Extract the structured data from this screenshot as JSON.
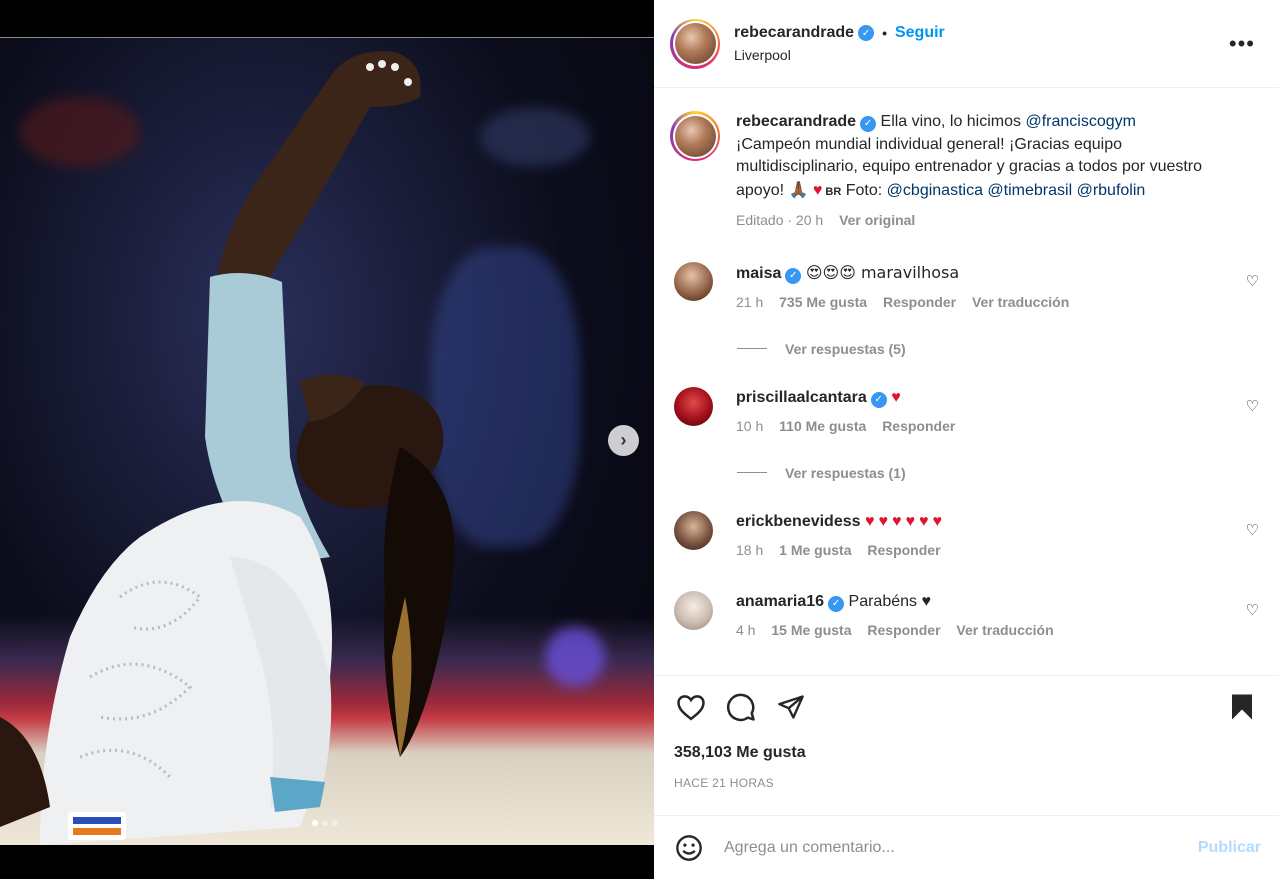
{
  "post": {
    "username": "rebecarandrade",
    "follow_label": "Seguir",
    "separator": "•",
    "location": "Liverpool",
    "more_label": "•••"
  },
  "caption": {
    "username": "rebecarandrade",
    "text_1": "Ella vino, lo hicimos ",
    "mention_1": "@franciscogym",
    "text_2": " ¡Campeón mundial individual general! ¡Gracias equipo multidisciplinario, equipo entrenador y gracias a todos por vuestro apoyo! ",
    "emojis": "🙏🏾",
    "heart": "♥",
    "flag": " BR",
    "text_3": " Foto: ",
    "mention_2": "@cbginastica",
    "mention_3": "@timebrasil",
    "mention_4": "@rbufolin",
    "edited": "Editado · 20 h",
    "see_original": "Ver original"
  },
  "comments": [
    {
      "username": "maisa",
      "verified": true,
      "text": "😍😍😍 maravilhosa",
      "time": "21 h",
      "likes": "735 Me gusta",
      "reply": "Responder",
      "translate": "Ver traducción",
      "replies": "Ver respuestas (5)"
    },
    {
      "username": "priscillaalcantara",
      "verified": true,
      "text": "♥",
      "time": "10 h",
      "likes": "110 Me gusta",
      "reply": "Responder",
      "translate": "",
      "replies": "Ver respuestas (1)"
    },
    {
      "username": "erickbenevidess",
      "verified": false,
      "text": "♥♥♥♥♥♥",
      "time": "18 h",
      "likes": "1 Me gusta",
      "reply": "Responder",
      "translate": "",
      "replies": ""
    },
    {
      "username": "anamaria16",
      "verified": true,
      "text": "Parabéns ♥",
      "time": "4 h",
      "likes": "15 Me gusta",
      "reply": "Responder",
      "translate": "Ver traducción",
      "replies": ""
    }
  ],
  "footer": {
    "likes": "358,103 Me gusta",
    "time_ago": "HACE 21 HORAS",
    "comment_placeholder": "Agrega un comentario...",
    "publish_label": "Publicar"
  },
  "icons": {
    "like": "heart-icon",
    "comment": "comment-icon",
    "share": "share-icon",
    "save": "bookmark-icon",
    "emoji": "emoji-icon",
    "next": "chevron-right-icon"
  },
  "carousel": {
    "next_label": "›",
    "total": 3,
    "active": 1
  },
  "colors": {
    "accent": "#0095f6",
    "heart": "#e0142e",
    "mention": "#00376b",
    "muted": "#8e8e8e"
  }
}
